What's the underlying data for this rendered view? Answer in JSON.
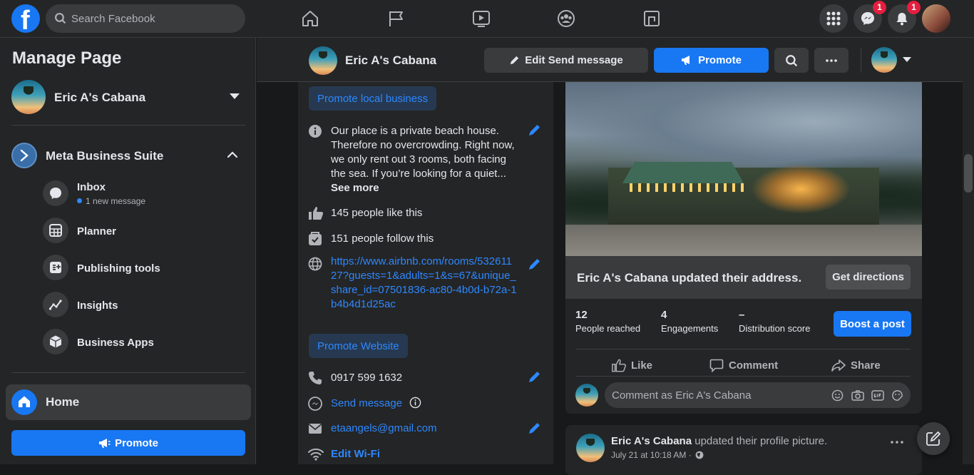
{
  "topbar": {
    "logo": "f",
    "search_placeholder": "Search Facebook",
    "nav_icons": [
      "home-icon",
      "flag-icon",
      "watch-icon",
      "groups-icon",
      "gaming-icon"
    ],
    "messenger_badge": "1",
    "notifications_badge": "1"
  },
  "sidebar": {
    "title": "Manage Page",
    "page_name": "Eric A's Cabana",
    "suite_label": "Meta Business Suite",
    "items": [
      {
        "label": "Inbox",
        "sub": "1 new message"
      },
      {
        "label": "Planner"
      },
      {
        "label": "Publishing tools"
      },
      {
        "label": "Insights"
      },
      {
        "label": "Business Apps"
      }
    ],
    "home_label": "Home",
    "promote_label": "Promote"
  },
  "page_header": {
    "name": "Eric A's Cabana",
    "edit_send_label": "Edit Send message",
    "promote_label": "Promote"
  },
  "about": {
    "promote_local_label": "Promote local business",
    "description": "Our place is a private beach house. Therefore no overcrowding. Right now, we only rent out 3 rooms, both facing the sea. If you’re looking for a quiet...",
    "see_more": "See more",
    "likes": "145 people like this",
    "follows": "151 people follow this",
    "website": "https://www.airbnb.com/rooms/53261127?guests=1&adults=1&s=67&unique_share_id=07501836-ac80-4b0d-b72a-1b4b4d1d25ac",
    "promote_website_label": "Promote Website",
    "phone": "0917 599 1632",
    "send_message": "Send message",
    "email": "etaangels@gmail.com",
    "wifi": "Edit Wi-Fi"
  },
  "post": {
    "update_text": "Eric A's Cabana updated their address.",
    "directions_label": "Get directions",
    "stats": [
      {
        "value": "12",
        "label": "People reached"
      },
      {
        "value": "4",
        "label": "Engagements"
      },
      {
        "value": "–",
        "label": "Distribution score"
      }
    ],
    "boost_label": "Boost a post",
    "like_label": "Like",
    "comment_label": "Comment",
    "share_label": "Share",
    "comment_placeholder": "Comment as Eric A's Cabana"
  },
  "post2": {
    "author": "Eric A's Cabana",
    "action": " updated their profile picture.",
    "time": "July 21 at 10:18 AM ·"
  },
  "colors": {
    "accent": "#1877f2",
    "link": "#2d88ff",
    "bg": "#18191a",
    "card": "#242526",
    "badge": "#e41e3f"
  }
}
